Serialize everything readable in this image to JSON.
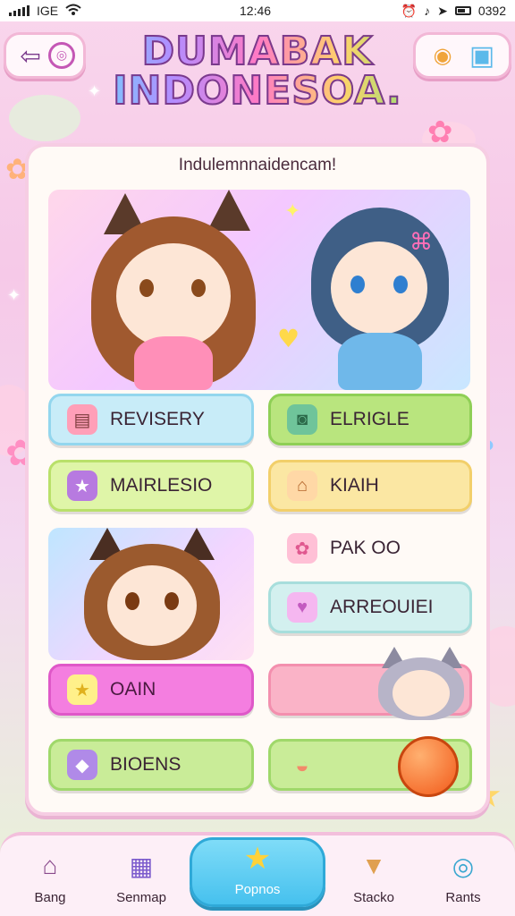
{
  "status_bar": {
    "network": "IGE",
    "time": "12:46",
    "right_text": "0392"
  },
  "top_left_buttons": [
    {
      "icon": "back-arrow-icon",
      "glyph": "⇦"
    },
    {
      "icon": "target-icon",
      "glyph": "◎"
    }
  ],
  "top_right_buttons": [
    {
      "icon": "ring-icon",
      "glyph": "◉"
    },
    {
      "icon": "cube-icon",
      "glyph": "▣"
    }
  ],
  "title": {
    "line1": "DUMABAK",
    "line2": "INDONESOA."
  },
  "panel": {
    "header": "Indulemnnaidencam!"
  },
  "menu": [
    {
      "id": "revisery",
      "label": "REVISERY",
      "icon_glyph": "▤"
    },
    {
      "id": "elrigle",
      "label": "ELRIGLE",
      "icon_glyph": "◙"
    },
    {
      "id": "mairlesio",
      "label": "MAIRLESIO",
      "icon_glyph": "★"
    },
    {
      "id": "kiaih",
      "label": "KIAIH",
      "icon_glyph": "⌂"
    },
    {
      "id": "pak-oo",
      "label": "PAK OO",
      "icon_glyph": "✿"
    },
    {
      "id": "arreouiei",
      "label": "ARREOUIEI",
      "icon_glyph": "♥"
    },
    {
      "id": "oain",
      "label": "OAIN",
      "icon_glyph": "★"
    },
    {
      "id": "blank",
      "label": "",
      "icon_glyph": ""
    },
    {
      "id": "bioens",
      "label": "BIOENS",
      "icon_glyph": "◆"
    },
    {
      "id": "cake",
      "label": "",
      "icon_glyph": "◒"
    }
  ],
  "bottom_nav": [
    {
      "id": "bang",
      "label": "Bang",
      "glyph": "⌂"
    },
    {
      "id": "senmap",
      "label": "Senmap",
      "glyph": "▦"
    },
    {
      "id": "popnos",
      "label": "Popnos",
      "glyph": "★"
    },
    {
      "id": "stacko",
      "label": "Stacko",
      "glyph": "▼"
    },
    {
      "id": "rants",
      "label": "Rants",
      "glyph": "◎"
    }
  ],
  "colors": {
    "accent": "#f3bfdc",
    "active_nav": "#46c1ee"
  }
}
